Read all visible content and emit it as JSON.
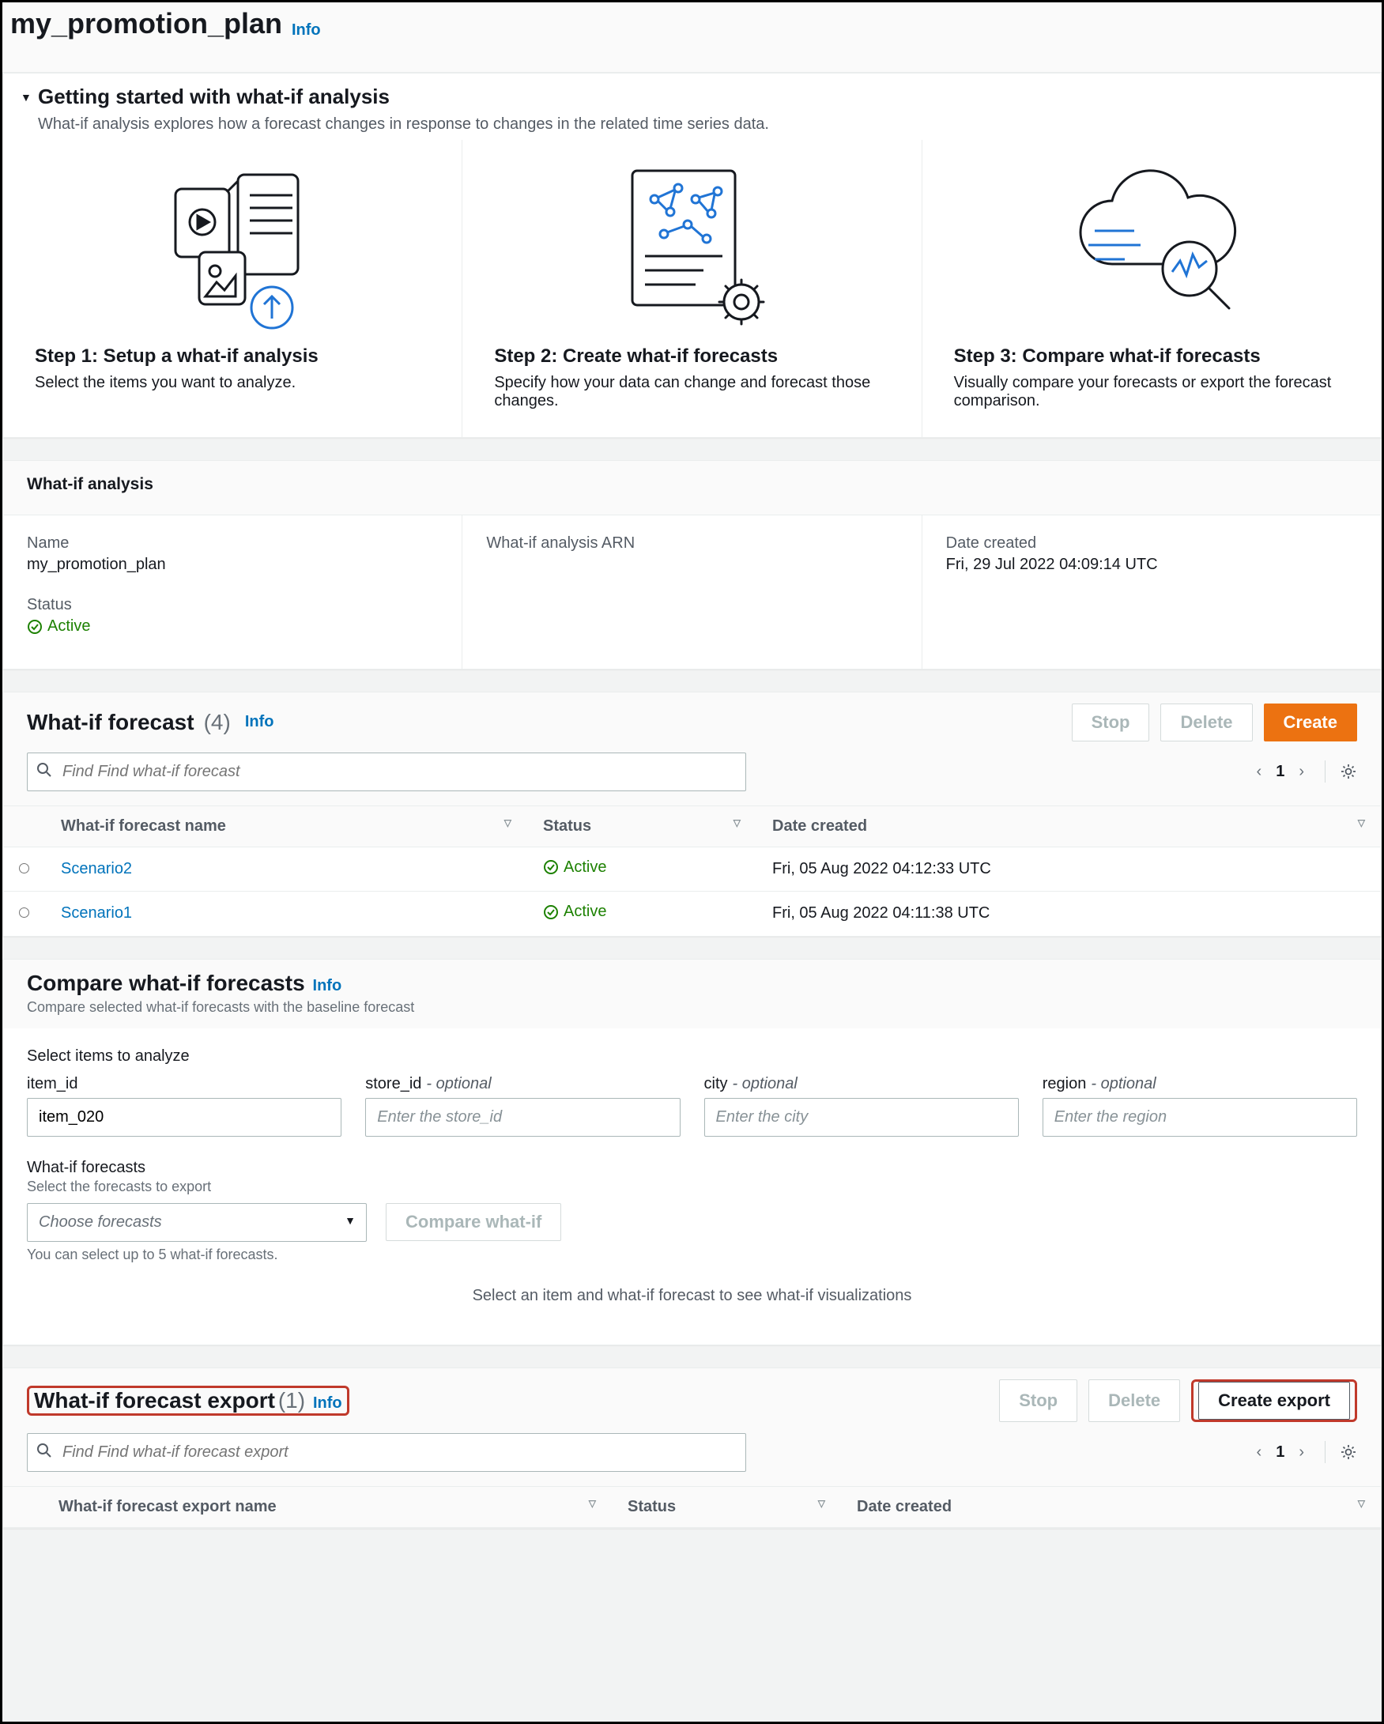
{
  "page": {
    "title": "my_promotion_plan",
    "info": "Info"
  },
  "getting_started": {
    "heading": "Getting started with what-if analysis",
    "description": "What-if analysis explores how a forecast changes in response to changes in the related time series data.",
    "steps": [
      {
        "title": "Step 1: Setup a what-if analysis",
        "desc": "Select the items you want to analyze."
      },
      {
        "title": "Step 2: Create what-if forecasts",
        "desc": "Specify how your data can change and forecast those changes."
      },
      {
        "title": "Step 3: Compare what-if forecasts",
        "desc": "Visually compare your forecasts or export the forecast comparison."
      }
    ]
  },
  "analysis": {
    "heading": "What-if analysis",
    "fields": {
      "name_label": "Name",
      "name_value": "my_promotion_plan",
      "arn_label": "What-if analysis ARN",
      "date_label": "Date created",
      "date_value": "Fri, 29 Jul 2022 04:09:14 UTC",
      "status_label": "Status",
      "status_value": "Active"
    }
  },
  "forecasts": {
    "heading": "What-if forecast",
    "count": "(4)",
    "info": "Info",
    "buttons": {
      "stop": "Stop",
      "delete": "Delete",
      "create": "Create"
    },
    "search_placeholder": "Find Find what-if forecast",
    "page_num": "1",
    "columns": {
      "name": "What-if forecast name",
      "status": "Status",
      "date": "Date created"
    },
    "rows": [
      {
        "name": "Scenario2",
        "status": "Active",
        "date": "Fri, 05 Aug 2022 04:12:33 UTC"
      },
      {
        "name": "Scenario1",
        "status": "Active",
        "date": "Fri, 05 Aug 2022 04:11:38 UTC"
      }
    ]
  },
  "compare": {
    "heading": "Compare what-if forecasts",
    "info": "Info",
    "sub": "Compare selected what-if forecasts with the baseline forecast",
    "select_items_heading": "Select items to analyze",
    "fields": {
      "item_id": {
        "label": "item_id",
        "value": "item_020"
      },
      "store_id": {
        "label": "store_id",
        "opt": "- optional",
        "placeholder": "Enter the store_id"
      },
      "city": {
        "label": "city",
        "opt": "- optional",
        "placeholder": "Enter the city"
      },
      "region": {
        "label": "region",
        "opt": "- optional",
        "placeholder": "Enter the region"
      }
    },
    "forecasts_label": "What-if forecasts",
    "forecasts_sub": "Select the forecasts to export",
    "forecasts_select_placeholder": "Choose forecasts",
    "compare_btn": "Compare what-if",
    "helper": "You can select up to 5 what-if forecasts.",
    "viz_hint": "Select an item and what-if forecast to see what-if visualizations"
  },
  "exports": {
    "heading": "What-if forecast export",
    "count": "(1)",
    "info": "Info",
    "buttons": {
      "stop": "Stop",
      "delete": "Delete",
      "create": "Create export"
    },
    "search_placeholder": "Find Find what-if forecast export",
    "page_num": "1",
    "columns": {
      "name": "What-if forecast export name",
      "status": "Status",
      "date": "Date created"
    }
  }
}
